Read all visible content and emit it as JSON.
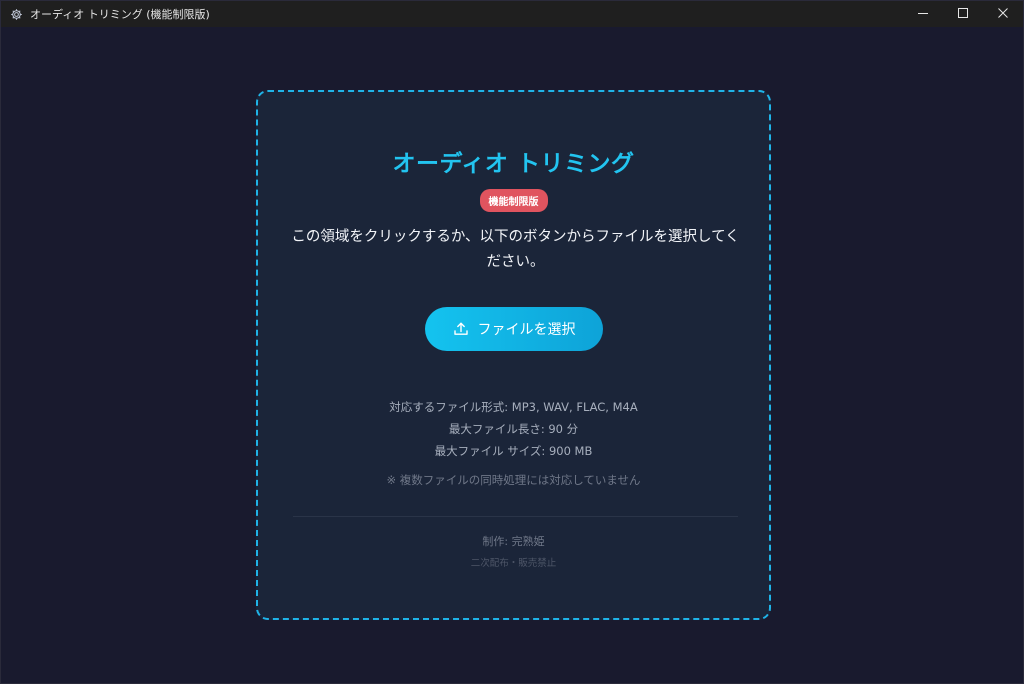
{
  "window": {
    "title": "オーディオ トリミング (機能制限版)",
    "app_icon": "gear-icon",
    "controls": [
      "minimize-icon",
      "maximize-icon",
      "close-icon"
    ]
  },
  "card": {
    "title": "オーディオ トリミング",
    "badge": "機能制限版",
    "instruction": "この領域をクリックするか、以下のボタンからファイルを選択してください。",
    "button_label": "ファイルを選択",
    "button_icon": "upload-icon",
    "formats": "対応するファイル形式: MP3, WAV, FLAC, M4A",
    "max_length": "最大ファイル長さ: 90 分",
    "max_size": "最大ファイル サイズ: 900 MB",
    "note": "※ 複数ファイルの同時処理には対応していません",
    "credit": "制作: 完熟姫",
    "credit_sub": "二次配布・販売禁止"
  },
  "colors": {
    "accent": "#22c4f0",
    "badge": "#e0545f",
    "background": "#191a2e",
    "card_background": "#1b2539"
  }
}
